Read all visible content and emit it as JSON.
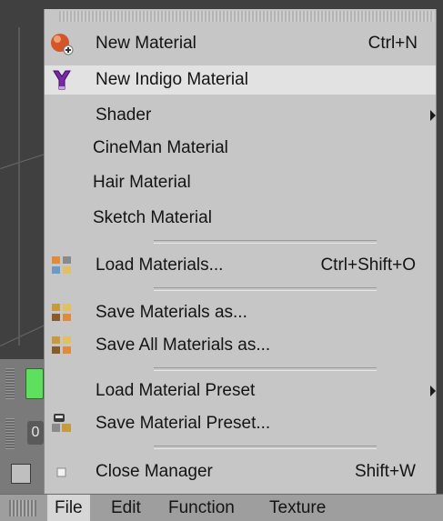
{
  "menu": {
    "items": [
      {
        "label": "New Material",
        "shortcut": "Ctrl+N",
        "icon": "new-material-icon"
      },
      {
        "label": "New Indigo Material",
        "shortcut": "",
        "icon": "indigo-icon"
      },
      {
        "label": "Shader",
        "shortcut": "",
        "submenu": true
      },
      {
        "label": "CineMan Material",
        "shortcut": ""
      },
      {
        "label": "Hair Material",
        "shortcut": ""
      },
      {
        "label": "Sketch Material",
        "shortcut": ""
      },
      {
        "label": "Load Materials...",
        "shortcut": "Ctrl+Shift+O",
        "icon": "load-materials-icon"
      },
      {
        "label": "Save Materials as...",
        "shortcut": "",
        "icon": "save-materials-icon"
      },
      {
        "label": "Save All Materials as...",
        "shortcut": "",
        "icon": "save-all-materials-icon"
      },
      {
        "label": "Load Material Preset",
        "shortcut": "",
        "submenu": true
      },
      {
        "label": "Save Material Preset...",
        "shortcut": "",
        "icon": "save-preset-icon"
      },
      {
        "label": "Close Manager",
        "shortcut": "Shift+W",
        "icon": "close-manager-icon"
      }
    ],
    "highlighted_index": 1
  },
  "menubar": {
    "items": [
      "File",
      "Edit",
      "Function",
      "Texture"
    ],
    "active": "File"
  },
  "side": {
    "zero_label": "0"
  },
  "colors": {
    "menu_bg": "#c6c6c6",
    "highlight": "#e2e2e2",
    "menubar_bg": "#9e9e9e",
    "green_swatch": "#5ee05e"
  }
}
